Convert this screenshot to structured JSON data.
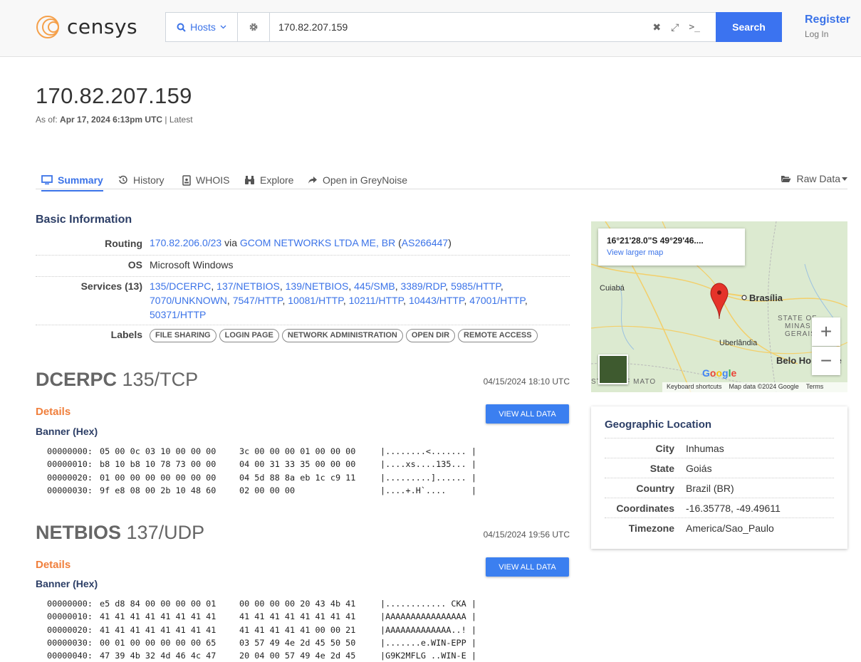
{
  "header": {
    "logo_text": "censys",
    "search_type": "Hosts",
    "search_value": "170.82.207.159",
    "search_button": "Search",
    "register": "Register",
    "login": "Log In"
  },
  "page": {
    "title": "170.82.207.159",
    "as_of_prefix": "As of:",
    "as_of_date": "Apr 17, 2024 6:13pm UTC",
    "as_of_suffix": " | Latest"
  },
  "tabs": {
    "summary": "Summary",
    "history": "History",
    "whois": "WHOIS",
    "explore": "Explore",
    "greynoise": "Open in GreyNoise",
    "raw_data": "Raw Data"
  },
  "basic_info": {
    "title": "Basic Information",
    "routing_label": "Routing",
    "routing_prefix": "170.82.206.0/23",
    "routing_via": " via ",
    "routing_org": "GCOM NETWORKS LTDA ME, BR",
    "routing_asn": "AS266447",
    "os_label": "OS",
    "os_value": "Microsoft Windows",
    "services_label": "Services (13)",
    "services": [
      "135/DCERPC",
      "137/NETBIOS",
      "139/NETBIOS",
      "445/SMB",
      "3389/RDP",
      "5985/HTTP",
      "7070/UNKNOWN",
      "7547/HTTP",
      "10081/HTTP",
      "10211/HTTP",
      "10443/HTTP",
      "47001/HTTP",
      "50371/HTTP"
    ],
    "labels_label": "Labels",
    "labels": [
      "FILE SHARING",
      "LOGIN PAGE",
      "NETWORK ADMINISTRATION",
      "OPEN DIR",
      "REMOTE ACCESS"
    ]
  },
  "service_blocks": [
    {
      "name": "DCERPC",
      "port": "135/TCP",
      "date": "04/15/2024 18:10 UTC",
      "details_label": "Details",
      "view_all": "VIEW ALL DATA",
      "banner_label": "Banner (Hex)",
      "rows": [
        {
          "off": "00000000:",
          "b1": "05 00 0c 03 10 00 00 00",
          "b2": "3c 00 00 00 01 00 00 00",
          "ascii": "|........<....... |"
        },
        {
          "off": "00000010:",
          "b1": "b8 10 b8 10 78 73 00 00",
          "b2": "04 00 31 33 35 00 00 00",
          "ascii": "|....xs....135... |"
        },
        {
          "off": "00000020:",
          "b1": "01 00 00 00 00 00 00 00",
          "b2": "04 5d 88 8a eb 1c c9 11",
          "ascii": "|.........]...... |"
        },
        {
          "off": "00000030:",
          "b1": "9f e8 08 00 2b 10 48 60",
          "b2": "02 00 00 00",
          "ascii": "|....+.H`....     |"
        }
      ]
    },
    {
      "name": "NETBIOS",
      "port": "137/UDP",
      "date": "04/15/2024 19:56 UTC",
      "details_label": "Details",
      "view_all": "VIEW ALL DATA",
      "banner_label": "Banner (Hex)",
      "rows": [
        {
          "off": "00000000:",
          "b1": "e5 d8 84 00 00 00 00 01",
          "b2": "00 00 00 00 20 43 4b 41",
          "ascii": "|............ CKA |"
        },
        {
          "off": "00000010:",
          "b1": "41 41 41 41 41 41 41 41",
          "b2": "41 41 41 41 41 41 41 41",
          "ascii": "|AAAAAAAAAAAAAAAA |"
        },
        {
          "off": "00000020:",
          "b1": "41 41 41 41 41 41 41 41",
          "b2": "41 41 41 41 41 00 00 21",
          "ascii": "|AAAAAAAAAAAAA..! |"
        },
        {
          "off": "00000030:",
          "b1": "00 01 00 00 00 00 00 65",
          "b2": "03 57 49 4e 2d 45 50 50",
          "ascii": "|.......e.WIN-EPP |"
        },
        {
          "off": "00000040:",
          "b1": "47 39 4b 32 4d 46 4c 47",
          "b2": "20 04 00 57 49 4e 2d 45",
          "ascii": "|G9K2MFLG ..WIN-E |"
        }
      ]
    }
  ],
  "map": {
    "coord_label": "16°21'28.0\"S 49°29'46....",
    "view_larger": "View larger map",
    "cities": [
      "Cuiabá",
      "Brasília",
      "Uberlândia",
      "Belo Horizonte"
    ],
    "states": [
      "STATE OF",
      "MINAS",
      "GERAIS",
      "STATE OF MATO"
    ],
    "footer": [
      "Keyboard shortcuts",
      "Map data ©2024 Google",
      "Terms"
    ],
    "google": "Google"
  },
  "geo": {
    "title": "Geographic Location",
    "rows": [
      {
        "k": "City",
        "v": "Inhumas"
      },
      {
        "k": "State",
        "v": "Goiás"
      },
      {
        "k": "Country",
        "v": "Brazil (BR)"
      },
      {
        "k": "Coordinates",
        "v": "-16.35778, -49.49611"
      },
      {
        "k": "Timezone",
        "v": "America/Sao_Paulo"
      }
    ]
  },
  "colors": {
    "accent": "#3b73e8",
    "search_button": "#3b73f0",
    "details": "#f07f3c",
    "heading": "#2c3e66",
    "logo_ring": "#f5a04a"
  }
}
